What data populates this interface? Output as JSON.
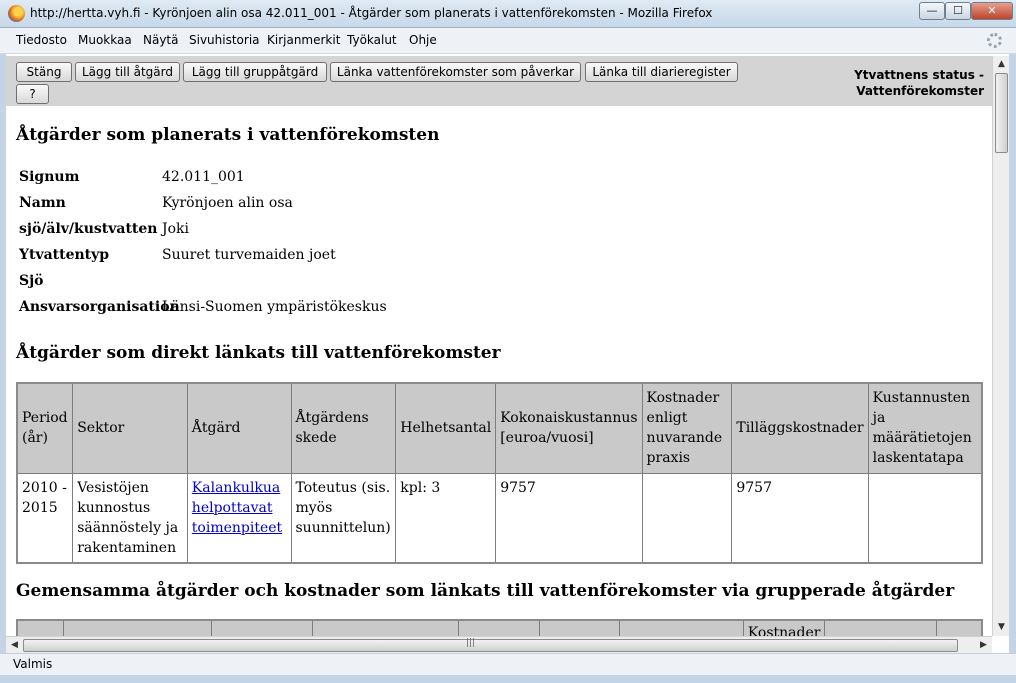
{
  "window": {
    "title": "http://hertta.vyh.fi - Kyrönjoen alin osa 42.011_001 - Åtgärder som planerats i vattenförekomsten - Mozilla Firefox",
    "min": "—",
    "max": "☐",
    "close": "✕"
  },
  "menu": [
    "Tiedosto",
    "Muokkaa",
    "Näytä",
    "Sivuhistoria",
    "Kirjanmerkit",
    "Työkalut",
    "Ohje"
  ],
  "toolbar": {
    "buttons": [
      "Stäng",
      "Lägg till åtgärd",
      "Lägg till gruppåtgärd",
      "Länka vattenförekomster som påverkar",
      "Länka till diarieregister"
    ],
    "help": "?",
    "status_line1": "Ytvattnens status -",
    "status_line2": "Vattenförekomster"
  },
  "page": {
    "heading": "Åtgärder som planerats i vattenförekomsten",
    "info": [
      {
        "label": "Signum",
        "value": "42.011_001"
      },
      {
        "label": "Namn",
        "value": "Kyrönjoen alin osa"
      },
      {
        "label": "sjö/älv/kustvatten",
        "value": "Joki"
      },
      {
        "label": "Ytvattentyp",
        "value": "Suuret turvemaiden joet"
      },
      {
        "label": "Sjö",
        "value": ""
      },
      {
        "label": "Ansvarsorganisation",
        "value": "Länsi-Suomen ympäristökeskus"
      }
    ],
    "direct_heading": "Åtgärder som direkt länkats till vattenförekomster",
    "direct_table": {
      "headers": [
        "Period (år)",
        "Sektor",
        "Åtgärd",
        "Åtgärdens skede",
        "Helhetsantal",
        "Kokonaiskustannus [euroa/vuosi]",
        "Kostnader enligt nuvarande praxis",
        "Tilläggskostnader",
        "Kustannusten ja määrätietojen laskentatapa"
      ],
      "rows": [
        {
          "period": "2010 - 2015",
          "sektor": "Vesistöjen kunnostus säännöstely ja rakentaminen",
          "atgard": "Kalankulkua helpottavat toimenpiteet",
          "skede": "Toteutus (sis. myös suunnittelun)",
          "antal": "kpl: 3",
          "total": "9757",
          "praxis": "",
          "tillagg": "9757",
          "metod": ""
        }
      ]
    },
    "group_heading": "Gemensamma åtgärder och kostnader som länkats till vattenförekomster via grupperade åtgärder",
    "group_partial_header": "Kostnader"
  },
  "statusbar": {
    "text": "Valmis"
  }
}
